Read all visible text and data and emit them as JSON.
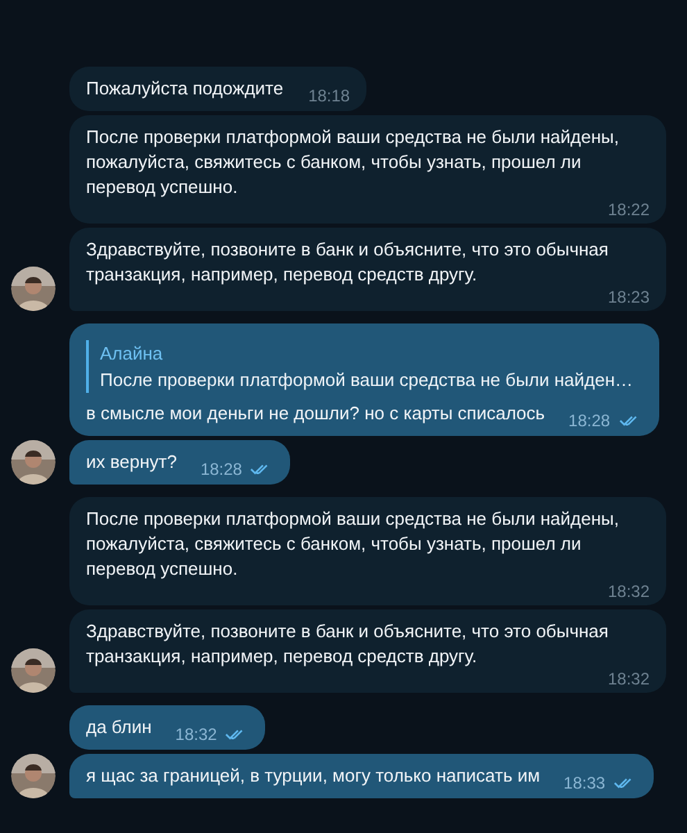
{
  "messages": [
    {
      "kind": "incoming",
      "text": "Пожалуйста подождите",
      "time": "18:18",
      "avatar": false
    },
    {
      "kind": "incoming",
      "text": "После проверки платформой ваши средства не были найдены, пожалуйста, свяжитесь с банком, чтобы узнать, прошел ли перевод успешно.",
      "time": "18:22",
      "avatar": false
    },
    {
      "kind": "incoming",
      "text": "Здравствуйте, позвоните в банк и объясните, что это обычная транзакция, например, перевод средств другу.",
      "time": "18:23",
      "avatar": true
    },
    {
      "kind": "outgoing",
      "reply": {
        "author": "Алайна",
        "text": "После проверки платформой ваши средства не были найден…"
      },
      "text": "в смысле мои деньги не дошли? но с карты списалось",
      "time": "18:28",
      "read": true,
      "avatar": false
    },
    {
      "kind": "outgoing",
      "text": "их вернут?",
      "time": "18:28",
      "read": true,
      "avatar": true
    },
    {
      "kind": "incoming",
      "text": "После проверки платформой ваши средства не были найдены, пожалуйста, свяжитесь с банком, чтобы узнать, прошел ли перевод успешно.",
      "time": "18:32",
      "avatar": false
    },
    {
      "kind": "incoming",
      "text": "Здравствуйте, позвоните в банк и объясните, что это обычная транзакция, например, перевод средств другу.",
      "time": "18:32",
      "avatar": true
    },
    {
      "kind": "outgoing",
      "text": "да блин",
      "time": "18:32",
      "read": true,
      "avatar": false
    },
    {
      "kind": "outgoing",
      "text": "я щас за границей, в турции, могу только написать им",
      "time": "18:33",
      "read": true,
      "avatar": true
    }
  ]
}
